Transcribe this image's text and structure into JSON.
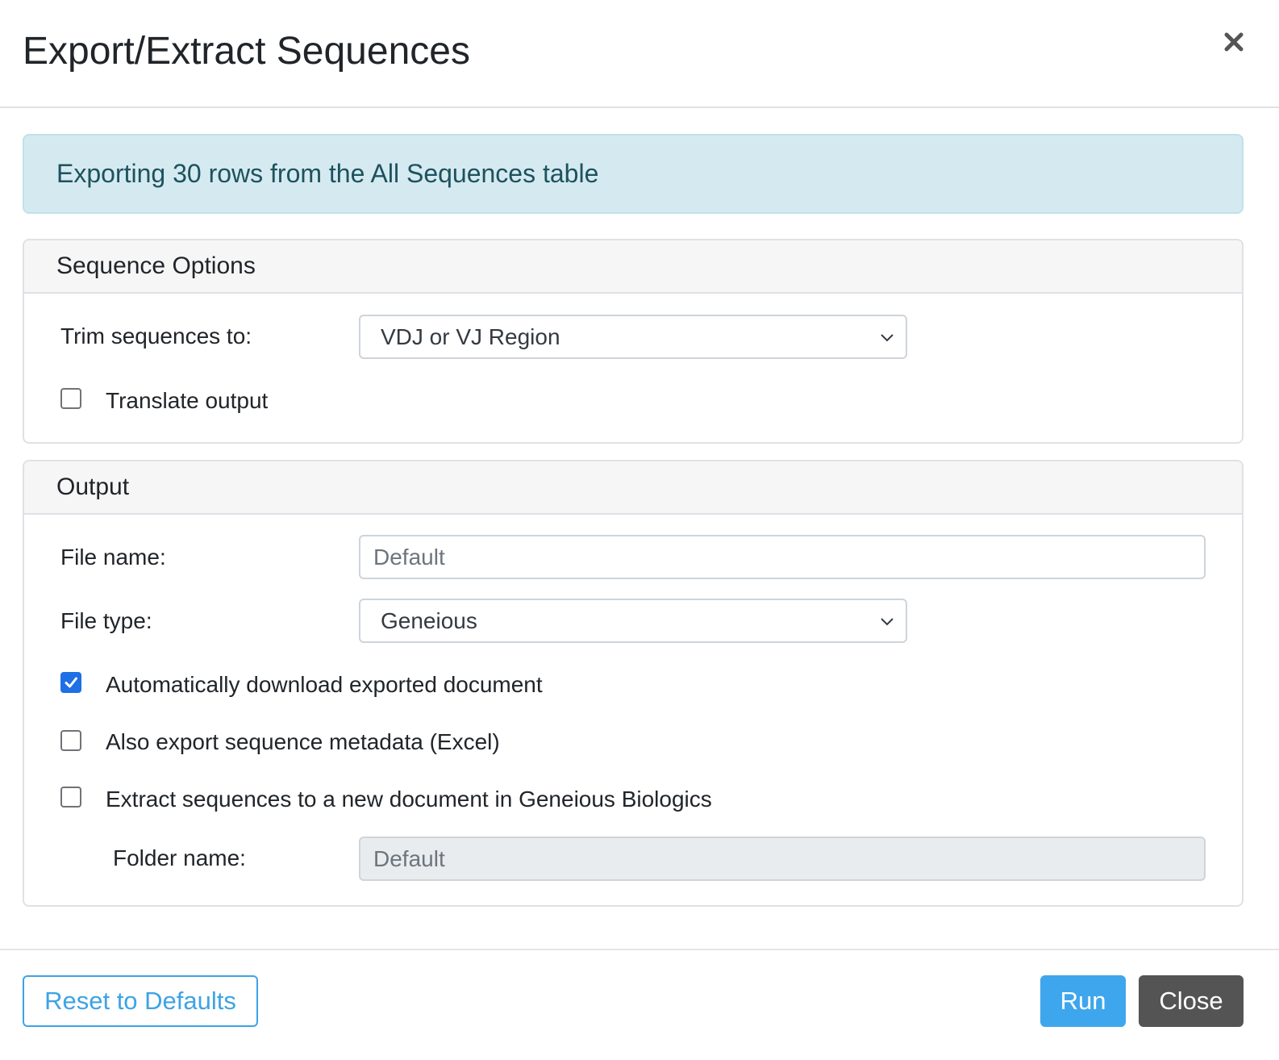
{
  "dialog": {
    "title": "Export/Extract Sequences",
    "close_icon": "close-icon"
  },
  "alert": {
    "text": "Exporting 30 rows from the All Sequences table"
  },
  "sequence_options": {
    "header": "Sequence Options",
    "trim_label": "Trim sequences to:",
    "trim_value": "VDJ or VJ Region",
    "translate_label": "Translate output",
    "translate_checked": false
  },
  "output": {
    "header": "Output",
    "file_name_label": "File name:",
    "file_name_placeholder": "Default",
    "file_type_label": "File type:",
    "file_type_value": "Geneious",
    "auto_download_label": "Automatically download exported document",
    "auto_download_checked": true,
    "export_metadata_label": "Also export sequence metadata (Excel)",
    "export_metadata_checked": false,
    "extract_label": "Extract sequences to a new document in Geneious Biologics",
    "extract_checked": false,
    "folder_name_label": "Folder name:",
    "folder_name_placeholder": "Default"
  },
  "footer": {
    "reset_label": "Reset to Defaults",
    "run_label": "Run",
    "close_label": "Close"
  },
  "colors": {
    "alert_bg": "#d5eaf0",
    "alert_text": "#1d525e",
    "checkbox_checked": "#1f6fe5",
    "run_button": "#3ea6ec",
    "close_button": "#545454",
    "reset_outline": "#3ea3e4"
  }
}
